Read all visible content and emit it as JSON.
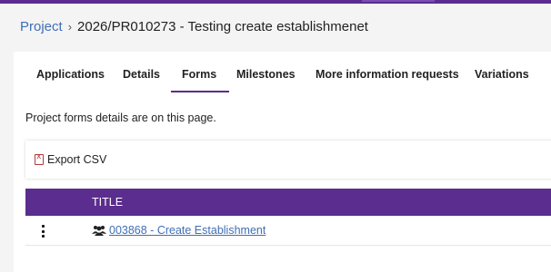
{
  "breadcrumb": {
    "root": "Project",
    "separator": "›",
    "current": "2026/PR010273 - Testing create establishmenet"
  },
  "tabs": [
    {
      "label": "Applications",
      "active": false
    },
    {
      "label": "Details",
      "active": false
    },
    {
      "label": "Forms",
      "active": true
    },
    {
      "label": "Milestones",
      "active": false
    },
    {
      "label": "More information requests",
      "active": false
    },
    {
      "label": "Variations",
      "active": false
    }
  ],
  "intro_text": "Project forms details are on this page.",
  "toolbar": {
    "export_label": "Export CSV",
    "export_icon": "csv-file-icon"
  },
  "table": {
    "columns": [
      "TITLE"
    ],
    "rows": [
      {
        "title": "003868 - Create Establishment",
        "icon": "group-icon"
      }
    ]
  },
  "colors": {
    "accent": "#5b2d8e",
    "link": "#3f6fb5"
  }
}
